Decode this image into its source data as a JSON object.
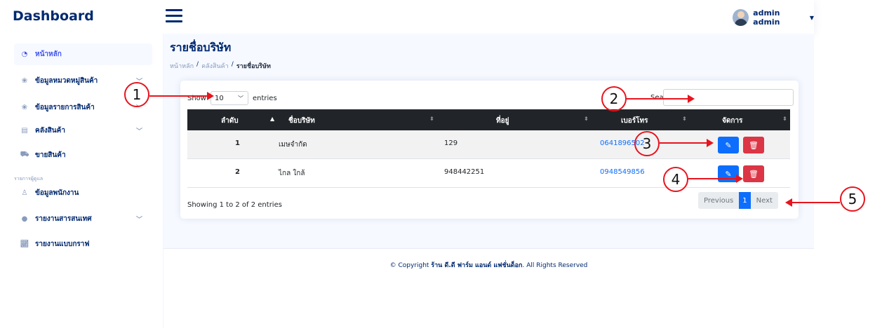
{
  "header": {
    "brand": "Dashboard",
    "user_name": "admin admin"
  },
  "sidebar": {
    "items": [
      {
        "label": "หน้าหลัก",
        "icon": "speedometer-icon"
      },
      {
        "label": "ข้อมูลหมวดหมู่สินค้า",
        "icon": "paw-icon"
      },
      {
        "label": "ข้อมูลรายการสินค้า",
        "icon": "paw-icon"
      },
      {
        "label": "คลังสินค้า",
        "icon": "archive-icon"
      },
      {
        "label": "ขายสินค้า",
        "icon": "cart-icon"
      },
      {
        "label": "ข้อมูลพนักงาน",
        "icon": "person-icon"
      },
      {
        "label": "รายงานสารสนเทศ",
        "icon": "info-icon"
      },
      {
        "label": "รายงานแบบกราฟ",
        "icon": "graph-icon"
      }
    ],
    "heading": "รายการผู้ดูแล"
  },
  "page": {
    "title": "รายชื่อบริษัท",
    "breadcrumb": [
      "หน้าหลัก",
      "คลังสินค้า",
      "รายชื่อบริษัท"
    ]
  },
  "table_controls": {
    "show_label": "Show",
    "entries_value": "10",
    "entries_label": "entries",
    "search_label": "Search:"
  },
  "table": {
    "columns": [
      "ลำดับ",
      "ชื่อบริษัท",
      "ที่อยู่",
      "เบอร์โทร",
      "จัดการ"
    ],
    "rows": [
      {
        "no": "1",
        "company": "เมษจำกัด",
        "address": "129",
        "phone": "0641896502"
      },
      {
        "no": "2",
        "company": "ไกล ใกล้",
        "address": "948442251",
        "phone": "0948549856"
      }
    ]
  },
  "footer_table": {
    "info": "Showing 1 to 2 of 2 entries",
    "prev": "Previous",
    "page": "1",
    "next": "Next"
  },
  "footer": {
    "prefix": "© Copyright ",
    "shop": "ร้าน ดี.ดี ฟาร์ม แอนด์ แฟชั่นด็อก",
    "suffix": ". All Rights Reserved"
  },
  "annotations": [
    "1",
    "2",
    "3",
    "4",
    "5"
  ],
  "colors": {
    "brand": "#012970",
    "accent": "#4154f1",
    "edit": "#0d6efd",
    "delete": "#dc3545",
    "annotation": "#e8141e"
  }
}
